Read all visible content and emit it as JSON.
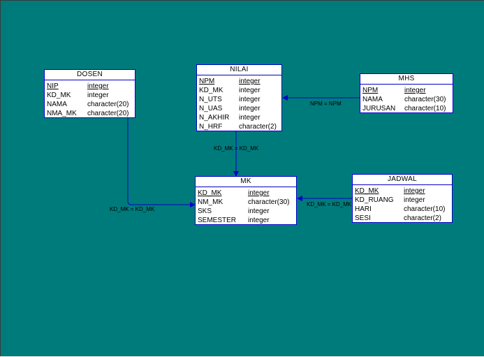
{
  "entities": {
    "dosen": {
      "title": "DOSEN",
      "columns": [
        {
          "name": "NIP",
          "type": "integer",
          "pk": true
        },
        {
          "name": "KD_MK",
          "type": "integer",
          "pk": false
        },
        {
          "name": "NAMA",
          "type": "character(20)",
          "pk": false
        },
        {
          "name": "NMA_MK",
          "type": "character(20)",
          "pk": false
        }
      ]
    },
    "nilai": {
      "title": "NILAI",
      "columns": [
        {
          "name": "NPM",
          "type": "integer",
          "pk": true
        },
        {
          "name": "KD_MK",
          "type": "integer",
          "pk": false
        },
        {
          "name": "N_UTS",
          "type": "integer",
          "pk": false
        },
        {
          "name": "N_UAS",
          "type": "integer",
          "pk": false
        },
        {
          "name": "N_AKHIR",
          "type": "integer",
          "pk": false
        },
        {
          "name": "N_HRF",
          "type": "character(2)",
          "pk": false
        }
      ]
    },
    "mhs": {
      "title": "MHS",
      "columns": [
        {
          "name": "NPM",
          "type": "integer",
          "pk": true
        },
        {
          "name": "NAMA",
          "type": "character(30)",
          "pk": false
        },
        {
          "name": "JURUSAN",
          "type": "character(10)",
          "pk": false
        }
      ]
    },
    "mk": {
      "title": "MK",
      "columns": [
        {
          "name": "KD_MK",
          "type": "integer",
          "pk": true
        },
        {
          "name": "NM_MK",
          "type": "character(30)",
          "pk": false
        },
        {
          "name": "SKS",
          "type": "integer",
          "pk": false
        },
        {
          "name": "SEMESTER",
          "type": "integer",
          "pk": false
        }
      ]
    },
    "jadwal": {
      "title": "JADWAL",
      "columns": [
        {
          "name": "KD_MK",
          "type": "integer",
          "pk": true
        },
        {
          "name": "KD_RUANG",
          "type": "integer",
          "pk": false
        },
        {
          "name": "HARI",
          "type": "character(10)",
          "pk": false
        },
        {
          "name": "SESI",
          "type": "character(2)",
          "pk": false
        }
      ]
    }
  },
  "relationships": [
    {
      "from": "mhs",
      "to": "nilai",
      "label": "NPM = NPM"
    },
    {
      "from": "nilai",
      "to": "mk",
      "label": "KD_MK = KD_MK"
    },
    {
      "from": "dosen",
      "to": "mk",
      "label": "KD_MK = KD_MK"
    },
    {
      "from": "jadwal",
      "to": "mk",
      "label": "KD_MK = KD_MK"
    }
  ],
  "colors": {
    "background": "#007b7b",
    "border": "#0000c8",
    "link": "#0000c8",
    "entity_fill": "#ffffff"
  }
}
